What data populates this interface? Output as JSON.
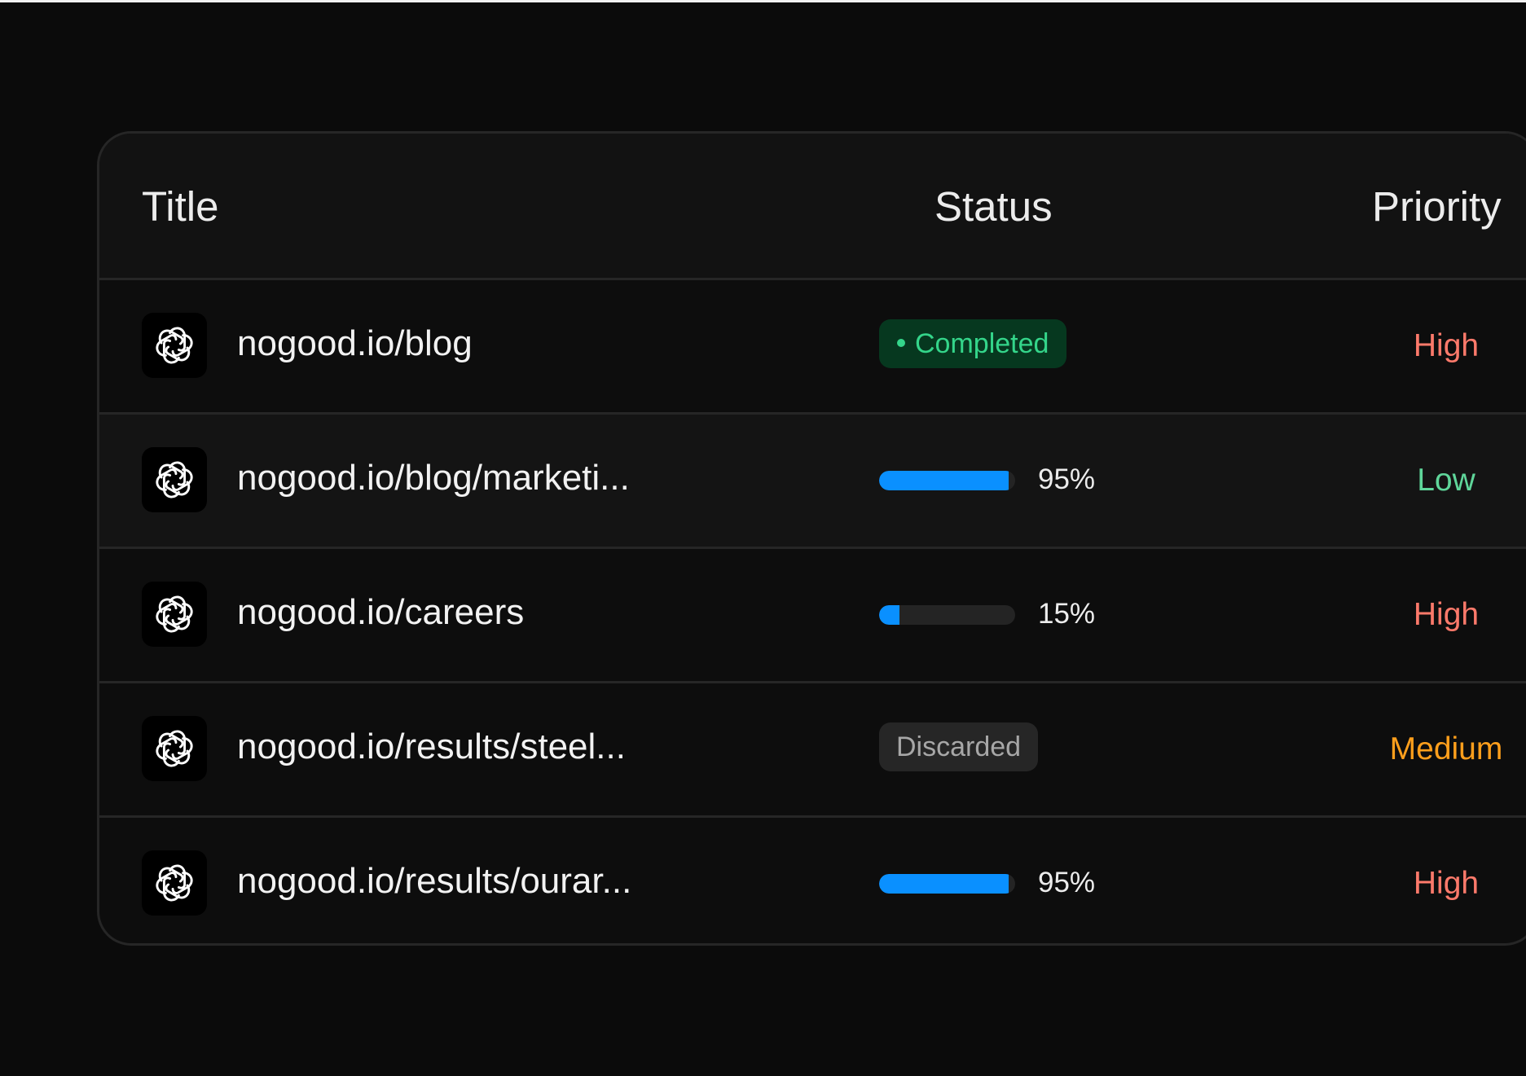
{
  "colors": {
    "high": "#ff7a6b",
    "low": "#5fd69a",
    "medium": "#ff9f1c",
    "progress": "#0a90ff"
  },
  "table": {
    "headers": {
      "title": "Title",
      "status": "Status",
      "priority": "Priority"
    },
    "rows": [
      {
        "title": "nogood.io/blog",
        "icon": "openai-logo-icon",
        "status_type": "badge",
        "status": "Completed",
        "priority": "High"
      },
      {
        "title": "nogood.io/blog/marketi...",
        "icon": "openai-logo-icon",
        "status_type": "progress",
        "progress": 0.95,
        "status": "95%",
        "priority": "Low"
      },
      {
        "title": "nogood.io/careers",
        "icon": "openai-logo-icon",
        "status_type": "progress",
        "progress": 0.15,
        "status": "15%",
        "priority": "High"
      },
      {
        "title": "nogood.io/results/steel...",
        "icon": "openai-logo-icon",
        "status_type": "badge",
        "status": "Discarded",
        "priority": "Medium"
      },
      {
        "title": "nogood.io/results/ourar...",
        "icon": "openai-logo-icon",
        "status_type": "progress",
        "progress": 0.95,
        "status": "95%",
        "priority": "High"
      }
    ]
  }
}
